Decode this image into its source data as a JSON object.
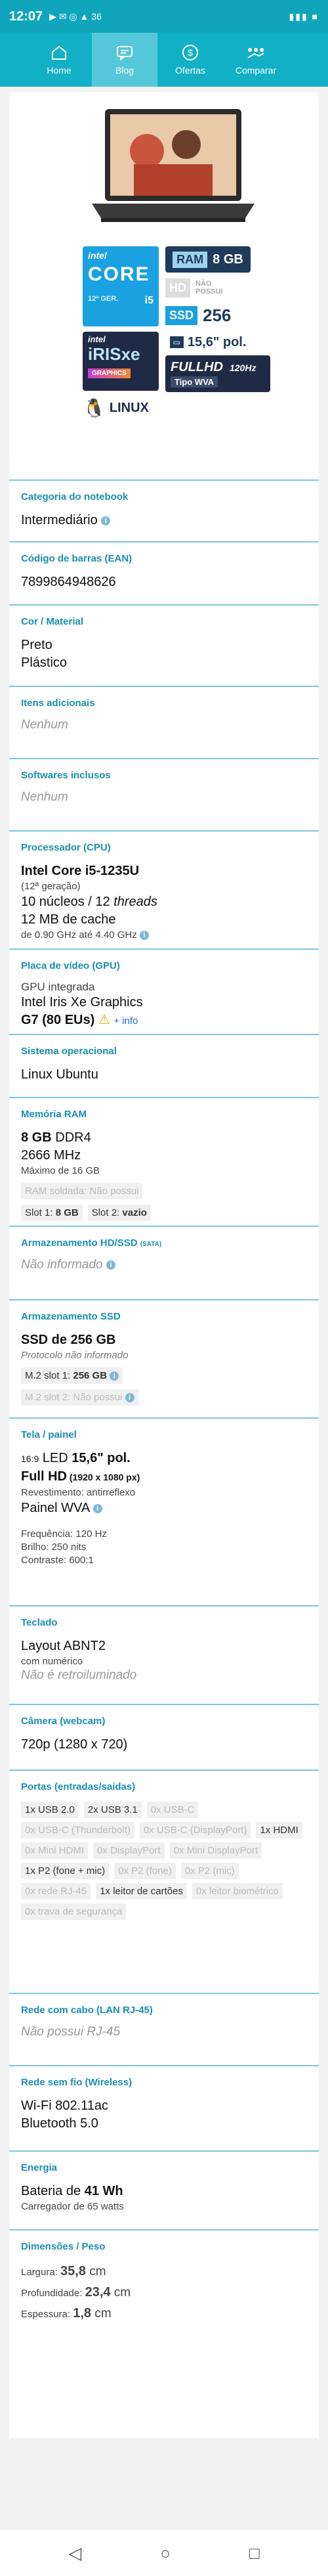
{
  "status": {
    "time": "12:07",
    "icons": "▶ ✉ ◎ ▲ 36"
  },
  "nav": [
    {
      "label": "Home",
      "icon": "home-icon"
    },
    {
      "label": "Blog",
      "icon": "chat-icon"
    },
    {
      "label": "Ofertas",
      "icon": "dollar-icon"
    },
    {
      "label": "Comparar",
      "icon": "compare-icon"
    }
  ],
  "badges": {
    "intel_core": "intel",
    "core": "CORE",
    "gen": "12ª GER.",
    "i5": "i5",
    "ram": "RAM",
    "ram_val": "8 GB",
    "hd": "HD",
    "hd_val": "NÃO POSSUI",
    "ssd": "SSD",
    "ssd_val": "256",
    "iris_intel": "intel",
    "iris": "iRISxe",
    "graphics": "GRAPHICS",
    "screen": "15,6\" pol.",
    "fullhd": "FULLHD",
    "hz": "120Hz",
    "wva": "Tipo WVA",
    "linux": "LINUX"
  },
  "sections": {
    "categoria": {
      "title": "Categoria do notebook",
      "value": "Intermediário"
    },
    "ean": {
      "title": "Código de barras (EAN)",
      "value": "7899864948626"
    },
    "cor": {
      "title": "Cor / Material",
      "value1": "Preto",
      "value2": "Plástico"
    },
    "itens": {
      "title": "Itens adicionais",
      "value": "Nenhum"
    },
    "softwares": {
      "title": "Softwares inclusos",
      "value": "Nenhum"
    },
    "cpu": {
      "title": "Processador (CPU)",
      "name": "Intel Core i5-1235U",
      "gen": "(12ª geração)",
      "cores_a": "10 núcleos / 12 ",
      "cores_b": "threads",
      "cache": "12 MB de cache",
      "freq": "de 0.90 GHz até 4.40 GHz"
    },
    "gpu": {
      "title": "Placa de vídeo (GPU)",
      "type": "GPU integrada",
      "name": "Intel Iris Xe Graphics",
      "eus": "G7 (80 EUs)",
      "more": "+ info"
    },
    "so": {
      "title": "Sistema operacional",
      "value": "Linux Ubuntu"
    },
    "ram": {
      "title": "Memória RAM",
      "size": "8 GB",
      "type": " DDR4",
      "speed": "2666 MHz",
      "max": "Máximo de 16 GB",
      "soldered": "RAM soldada: Não possui",
      "slot1_label": "Slot 1: ",
      "slot1_val": "8 GB",
      "slot2_label": "Slot 2: ",
      "slot2_val": "vazio"
    },
    "hd": {
      "title": "Armazenamento HD/SSD",
      "title_small": "(SATA)",
      "value": "Não informado"
    },
    "ssd": {
      "title": "Armazenamento SSD",
      "value": "SSD de 256 GB",
      "protocol": "Protocolo não informado",
      "m2_1_label": "M.2 slot 1: ",
      "m2_1_val": "256 GB",
      "m2_2": "M.2 slot 2: Não possui"
    },
    "tela": {
      "title": "Tela / painel",
      "ratio": "16:9",
      "size_a": " LED ",
      "size_b": "15,6\" pol.",
      "res": "Full HD",
      "res_px": " (1920 x 1080 px)",
      "coating": "Revestimento: antirreflexo",
      "panel": "Painel WVA",
      "freq": "Frequência: 120 Hz",
      "bright": "Brilho: 250 nits",
      "contrast": "Contraste: 600:1"
    },
    "teclado": {
      "title": "Teclado",
      "layout": "Layout ABNT2",
      "numpad": "com numérico",
      "backlit": "Não é retroiluminado"
    },
    "camera": {
      "title": "Câmera (webcam)",
      "value": "720p (1280 x 720)"
    },
    "portas": {
      "title": "Portas (entradas/saídas)",
      "items": [
        {
          "t": "1x USB 2.0",
          "on": true
        },
        {
          "t": "2x USB 3.1",
          "on": true
        },
        {
          "t": "0x USB-C",
          "on": false
        },
        {
          "t": "0x USB-C (Thunderbolt)",
          "on": false
        },
        {
          "t": "0x USB-C (DisplayPort)",
          "on": false
        },
        {
          "t": "1x HDMI",
          "on": true
        },
        {
          "t": "0x Mini HDMI",
          "on": false
        },
        {
          "t": "0x DisplayPort",
          "on": false
        },
        {
          "t": "0x Mini DisplayPort",
          "on": false
        },
        {
          "t": "1x P2 (fone + mic)",
          "on": true
        },
        {
          "t": "0x P2 (fone)",
          "on": false
        },
        {
          "t": "0x P2 (mic)",
          "on": false
        },
        {
          "t": "0x rede RJ-45",
          "on": false
        },
        {
          "t": "1x leitor de cartões",
          "on": true
        },
        {
          "t": "0x leitor biométrico",
          "on": false
        },
        {
          "t": "0x trava de segurança",
          "on": false
        }
      ]
    },
    "rede": {
      "title": "Rede com cabo (LAN RJ-45)",
      "value": "Não possui RJ-45"
    },
    "wifi": {
      "title": "Rede sem fio (Wireless)",
      "wifi": "Wi-Fi 802.11ac",
      "bt": "Bluetooth 5.0"
    },
    "energia": {
      "title": "Energia",
      "bat_a": "Bateria de ",
      "bat_b": "41 Wh",
      "charger": "Carregador de 65 watts"
    },
    "dim": {
      "title": "Dimensões / Peso",
      "larg_l": "Largura: ",
      "larg_v": "35,8",
      "larg_u": " cm",
      "prof_l": "Profundidade: ",
      "prof_v": "23,4",
      "prof_u": " cm",
      "esp_l": "Espessura: ",
      "esp_v": "1,8",
      "esp_u": " cm"
    }
  }
}
